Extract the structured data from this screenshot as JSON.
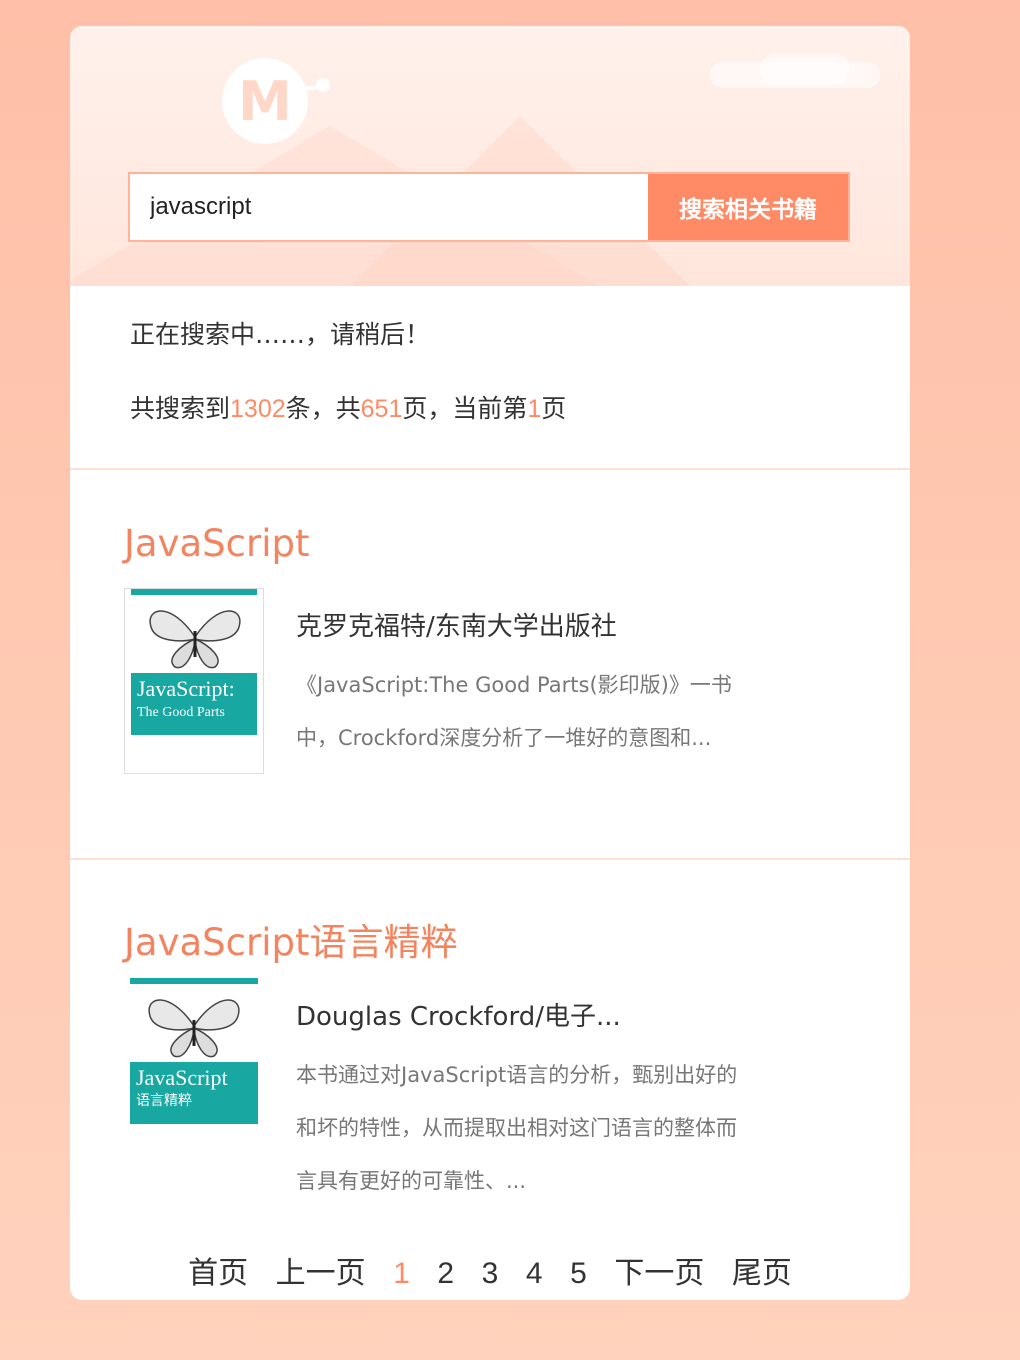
{
  "search": {
    "value": "javascript",
    "button_label": "搜索相关书籍"
  },
  "status": {
    "loading_text": "正在搜索中……，请稍后！",
    "summary_prefix": "共搜索到",
    "total_results": "1302",
    "summary_mid1": "条，共",
    "total_pages": "651",
    "summary_mid2": "页，当前第",
    "current_page": "1",
    "summary_suffix": "页"
  },
  "books": [
    {
      "title": "JavaScript",
      "author": "克罗克福特/东南大学出版社",
      "description": "《JavaScript:The Good Parts(影印版)》一书中，Crockford深度分析了一堆好的意图和...",
      "cover_title": "JavaScript:",
      "cover_subtitle": "The Good Parts"
    },
    {
      "title": "JavaScript语言精粹",
      "author": "Douglas Crockford/电子...",
      "description": "本书通过对JavaScript语言的分析，甄别出好的和坏的特性，从而提取出相对这门语言的整体而言具有更好的可靠性、...",
      "cover_title": "JavaScript",
      "cover_subtitle": "语言精粹"
    }
  ],
  "pagination": {
    "first": "首页",
    "prev": "上一页",
    "pages": [
      "1",
      "2",
      "3",
      "4",
      "5"
    ],
    "next": "下一页",
    "last": "尾页"
  },
  "colors": {
    "accent": "#ff8a66",
    "title": "#f3845f"
  }
}
